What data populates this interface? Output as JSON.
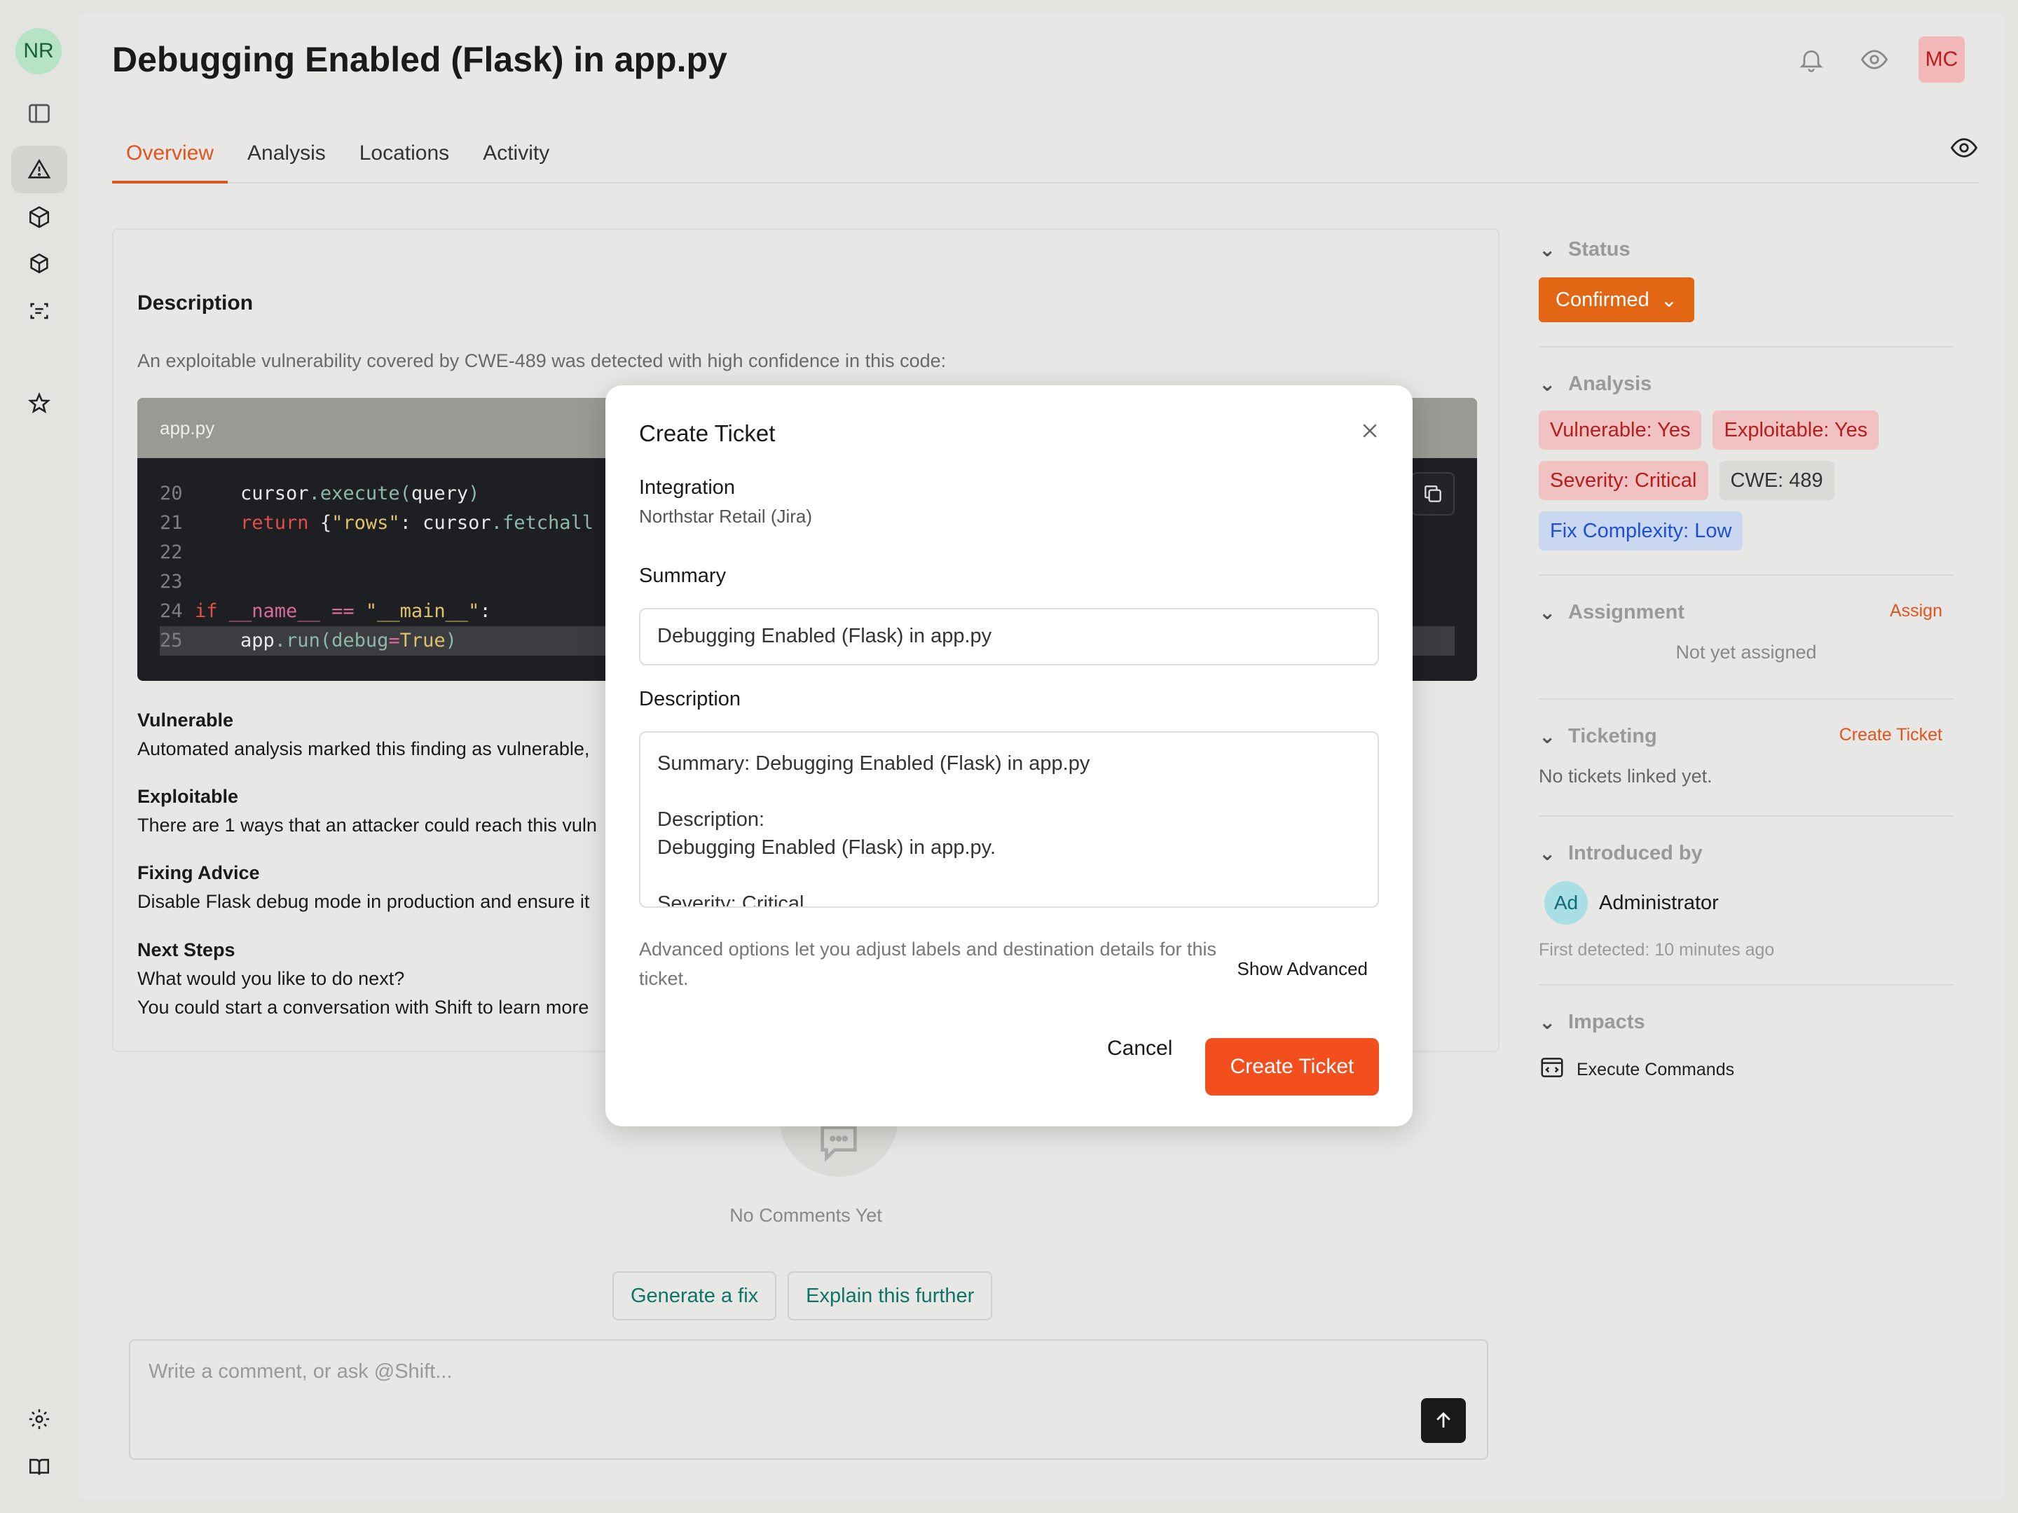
{
  "rail": {
    "avatar": "NR"
  },
  "header": {
    "title": "Debugging Enabled (Flask) in app.py",
    "user_initials": "MC"
  },
  "tabs": [
    "Overview",
    "Analysis",
    "Locations",
    "Activity"
  ],
  "description": {
    "title": "Description",
    "text": "An exploitable vulnerability covered by CWE-489 was detected with high confidence in this code:"
  },
  "code": {
    "filename": "app.py",
    "lines": [
      {
        "n": "20",
        "code": "    cursor.execute(query)"
      },
      {
        "n": "21",
        "code": "    return {\"rows\": cursor.fetchall"
      },
      {
        "n": "22",
        "code": ""
      },
      {
        "n": "23",
        "code": ""
      },
      {
        "n": "24",
        "code": "if __name__ == \"__main__\":"
      },
      {
        "n": "25",
        "code": "    app.run(debug=True)"
      }
    ]
  },
  "sections": {
    "vulnerable": {
      "title": "Vulnerable",
      "text": "Automated analysis marked this finding as vulnerable,"
    },
    "exploitable": {
      "title": "Exploitable",
      "text": "There are 1 ways that an attacker could reach this vuln"
    },
    "fixing": {
      "title": "Fixing Advice",
      "text": "Disable Flask debug mode in production and ensure it"
    },
    "next": {
      "title": "Next Steps",
      "line1": "What would you like to do next?",
      "line2": "You could start a conversation with Shift to learn more"
    }
  },
  "comments": {
    "empty": "No Comments Yet",
    "actions": [
      "Generate a fix",
      "Explain this further"
    ],
    "placeholder": "Write a comment, or ask @Shift..."
  },
  "sidebar": {
    "status": {
      "title": "Status",
      "value": "Confirmed"
    },
    "analysis": {
      "title": "Analysis",
      "badges": [
        "Vulnerable: Yes",
        "Exploitable: Yes",
        "Severity: Critical",
        "CWE: 489",
        "Fix Complexity: Low"
      ]
    },
    "assignment": {
      "title": "Assignment",
      "action": "Assign",
      "empty": "Not yet assigned"
    },
    "ticketing": {
      "title": "Ticketing",
      "action": "Create Ticket",
      "empty": "No tickets linked yet."
    },
    "introduced": {
      "title": "Introduced by",
      "initials": "Ad",
      "name": "Administrator",
      "first": "First detected: 10 minutes ago"
    },
    "impacts": {
      "title": "Impacts",
      "item": "Execute Commands"
    }
  },
  "modal": {
    "title": "Create Ticket",
    "integration_label": "Integration",
    "integration_value": "Northstar Retail (Jira)",
    "summary_label": "Summary",
    "summary_value": "Debugging Enabled (Flask) in app.py",
    "description_label": "Description",
    "description_value": "Summary: Debugging Enabled (Flask) in app.py\n\nDescription:\nDebugging Enabled (Flask) in app.py.\n\nSeverity: Critical",
    "advanced_text": "Advanced options let you adjust labels and destination details for this ticket.",
    "show_advanced": "Show Advanced",
    "cancel": "Cancel",
    "create": "Create Ticket"
  }
}
